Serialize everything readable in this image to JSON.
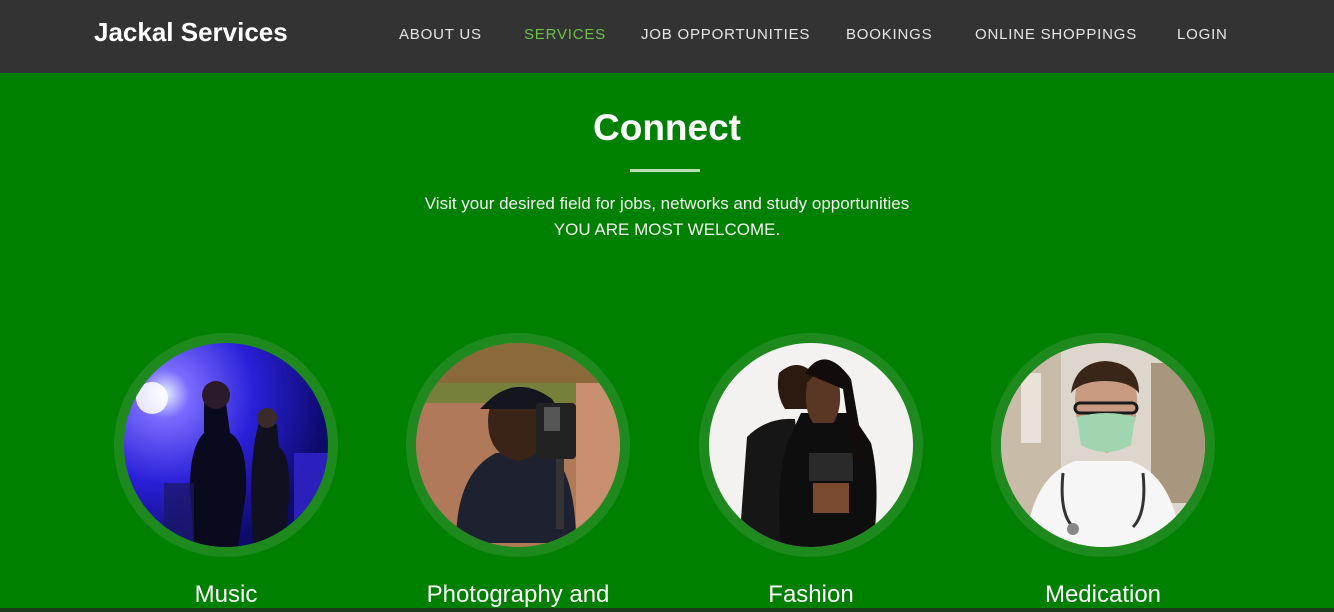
{
  "navbar": {
    "brand": "Jackal Services",
    "links": [
      {
        "label": "ABOUT US",
        "active": false
      },
      {
        "label": "SERVICES",
        "active": true
      },
      {
        "label": "JOB OPPORTUNITIES",
        "active": false
      },
      {
        "label": "BOOKINGS",
        "active": false
      },
      {
        "label": "ONLINE SHOPPINGS",
        "active": false
      },
      {
        "label": "LOGIN",
        "active": false
      }
    ]
  },
  "hero": {
    "title": "Connect",
    "subtitle_line1": "Visit your desired field for jobs, networks and study opportunities",
    "subtitle_line2": "YOU ARE MOST WELCOME."
  },
  "services": [
    {
      "label": "Music"
    },
    {
      "label": "Photography and"
    },
    {
      "label": "Fashion"
    },
    {
      "label": "Medication"
    }
  ],
  "colors": {
    "navbar_bg": "#333333",
    "page_bg": "#008000",
    "active_link": "#6cc04a",
    "circle_ring": "#1e8a1e"
  }
}
